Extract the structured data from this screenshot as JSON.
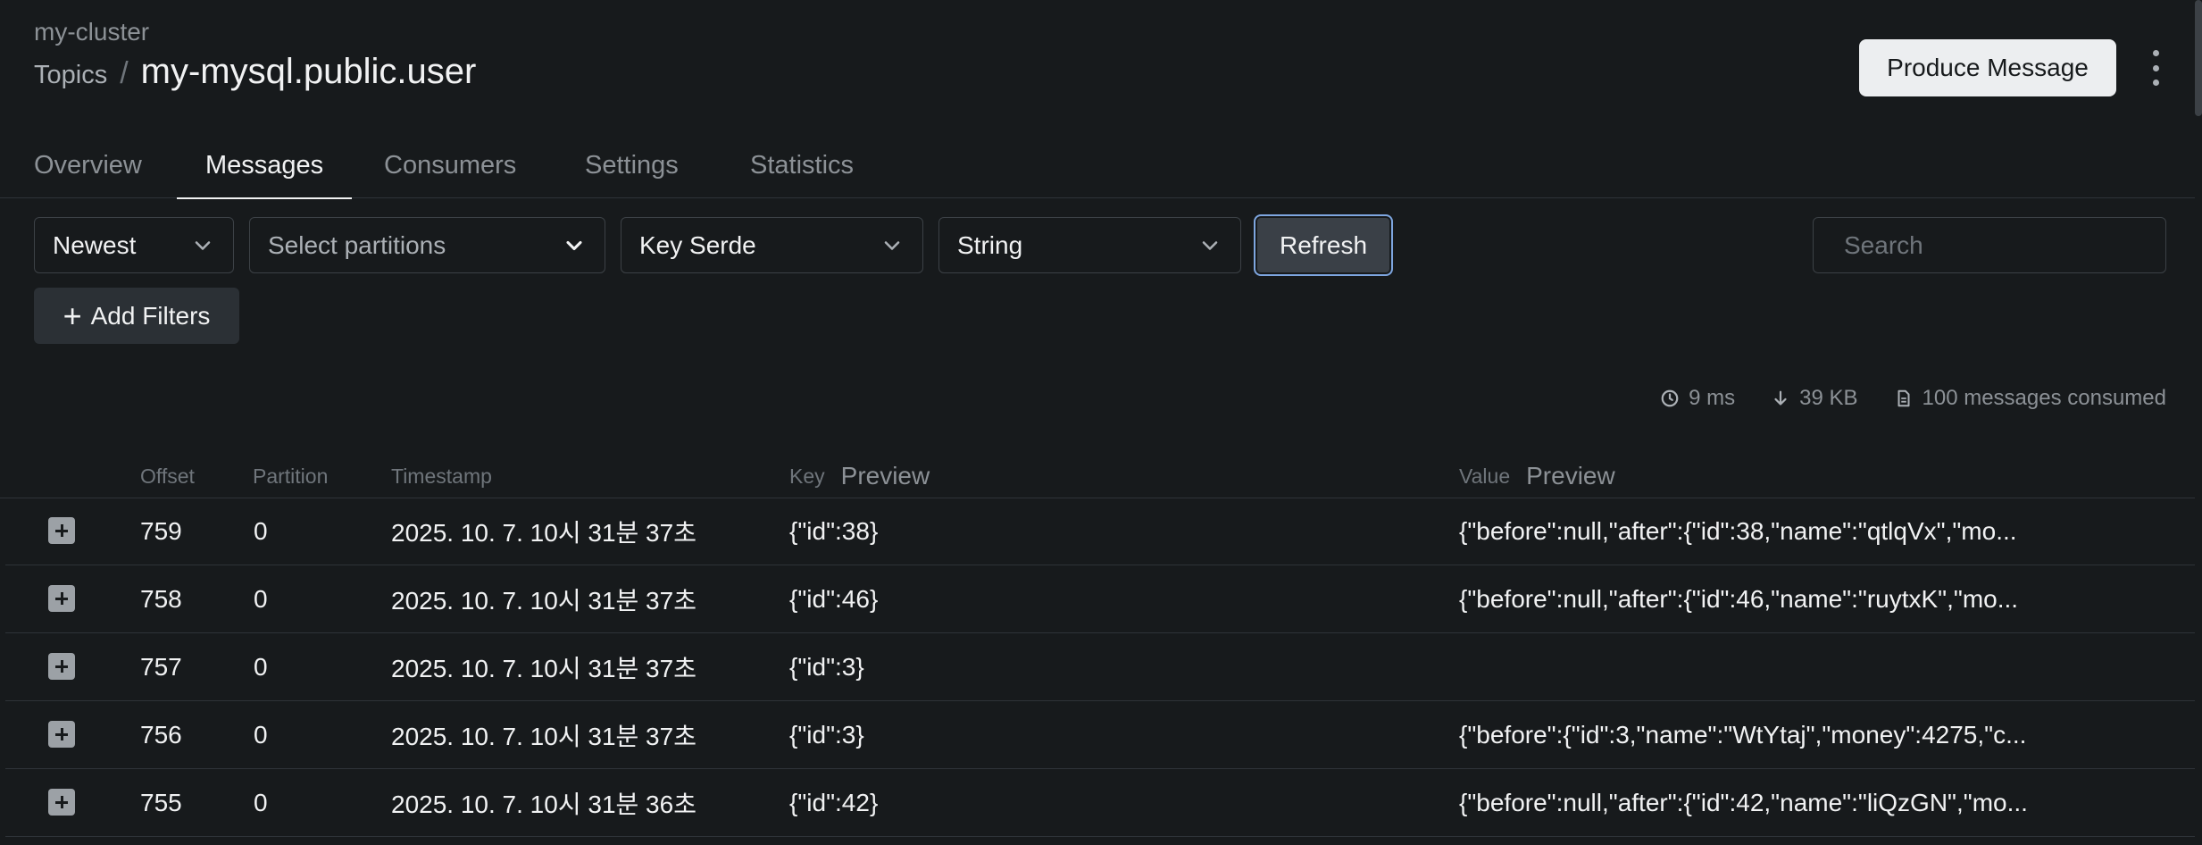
{
  "header": {
    "cluster": "my-cluster",
    "breadcrumb_link": "Topics",
    "separator": "/",
    "title": "my-mysql.public.user",
    "produce_label": "Produce Message"
  },
  "tabs": [
    {
      "label": "Overview"
    },
    {
      "label": "Messages",
      "active": true
    },
    {
      "label": "Consumers"
    },
    {
      "label": "Settings"
    },
    {
      "label": "Statistics"
    }
  ],
  "filters": {
    "seek": "Newest",
    "partitions_placeholder": "Select partitions",
    "key_serde": "Key Serde",
    "value_serde": "String",
    "refresh_label": "Refresh",
    "search_placeholder": "Search",
    "add_filters_label": "Add Filters"
  },
  "stats": {
    "time": "9 ms",
    "size": "39 KB",
    "consumed": "100 messages consumed"
  },
  "table": {
    "headers": {
      "offset": "Offset",
      "partition": "Partition",
      "timestamp": "Timestamp",
      "key": "Key",
      "key_preview": "Preview",
      "value": "Value",
      "value_preview": "Preview"
    },
    "rows": [
      {
        "offset": "759",
        "partition": "0",
        "timestamp": "2025. 10. 7. 10시 31분 37초",
        "key": "{\"id\":38}",
        "value": "{\"before\":null,\"after\":{\"id\":38,\"name\":\"qtlqVx\",\"mo..."
      },
      {
        "offset": "758",
        "partition": "0",
        "timestamp": "2025. 10. 7. 10시 31분 37초",
        "key": "{\"id\":46}",
        "value": "{\"before\":null,\"after\":{\"id\":46,\"name\":\"ruytxK\",\"mo..."
      },
      {
        "offset": "757",
        "partition": "0",
        "timestamp": "2025. 10. 7. 10시 31분 37초",
        "key": "{\"id\":3}",
        "value": ""
      },
      {
        "offset": "756",
        "partition": "0",
        "timestamp": "2025. 10. 7. 10시 31분 37초",
        "key": "{\"id\":3}",
        "value": "{\"before\":{\"id\":3,\"name\":\"WtYtaj\",\"money\":4275,\"c..."
      },
      {
        "offset": "755",
        "partition": "0",
        "timestamp": "2025. 10. 7. 10시 31분 36초",
        "key": "{\"id\":42}",
        "value": "{\"before\":null,\"after\":{\"id\":42,\"name\":\"liQzGN\",\"mo..."
      }
    ]
  }
}
